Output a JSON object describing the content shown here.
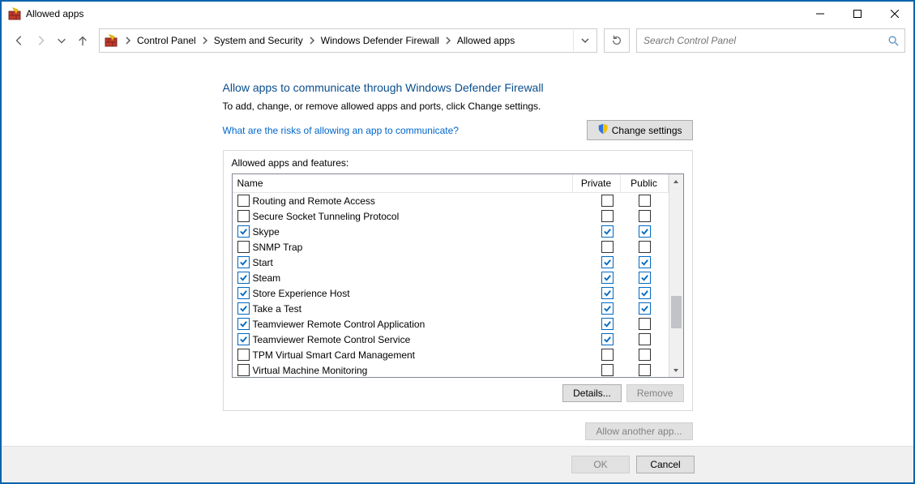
{
  "window": {
    "title": "Allowed apps"
  },
  "breadcrumb": {
    "root_label": "Control Panel",
    "group_label": "System and Security",
    "section_label": "Windows Defender Firewall",
    "page_label": "Allowed apps"
  },
  "search": {
    "placeholder": "Search Control Panel"
  },
  "main": {
    "heading": "Allow apps to communicate through Windows Defender Firewall",
    "subtext": "To add, change, or remove allowed apps and ports, click Change settings.",
    "risks_link": "What are the risks of allowing an app to communicate?",
    "change_settings_label": "Change settings",
    "groupbox_label": "Allowed apps and features:",
    "columns": {
      "name": "Name",
      "private": "Private",
      "public": "Public"
    },
    "rows": [
      {
        "name": "Routing and Remote Access",
        "enabled": false,
        "private": false,
        "public": false
      },
      {
        "name": "Secure Socket Tunneling Protocol",
        "enabled": false,
        "private": false,
        "public": false
      },
      {
        "name": "Skype",
        "enabled": true,
        "private": true,
        "public": true
      },
      {
        "name": "SNMP Trap",
        "enabled": false,
        "private": false,
        "public": false
      },
      {
        "name": "Start",
        "enabled": true,
        "private": true,
        "public": true
      },
      {
        "name": "Steam",
        "enabled": true,
        "private": true,
        "public": true
      },
      {
        "name": "Store Experience Host",
        "enabled": true,
        "private": true,
        "public": true
      },
      {
        "name": "Take a Test",
        "enabled": true,
        "private": true,
        "public": true
      },
      {
        "name": "Teamviewer Remote Control Application",
        "enabled": true,
        "private": true,
        "public": false
      },
      {
        "name": "Teamviewer Remote Control Service",
        "enabled": true,
        "private": true,
        "public": false
      },
      {
        "name": "TPM Virtual Smart Card Management",
        "enabled": false,
        "private": false,
        "public": false
      },
      {
        "name": "Virtual Machine Monitoring",
        "enabled": false,
        "private": false,
        "public": false
      }
    ],
    "details_label": "Details...",
    "remove_label": "Remove",
    "allow_another_label": "Allow another app..."
  },
  "footer": {
    "ok_label": "OK",
    "cancel_label": "Cancel"
  }
}
